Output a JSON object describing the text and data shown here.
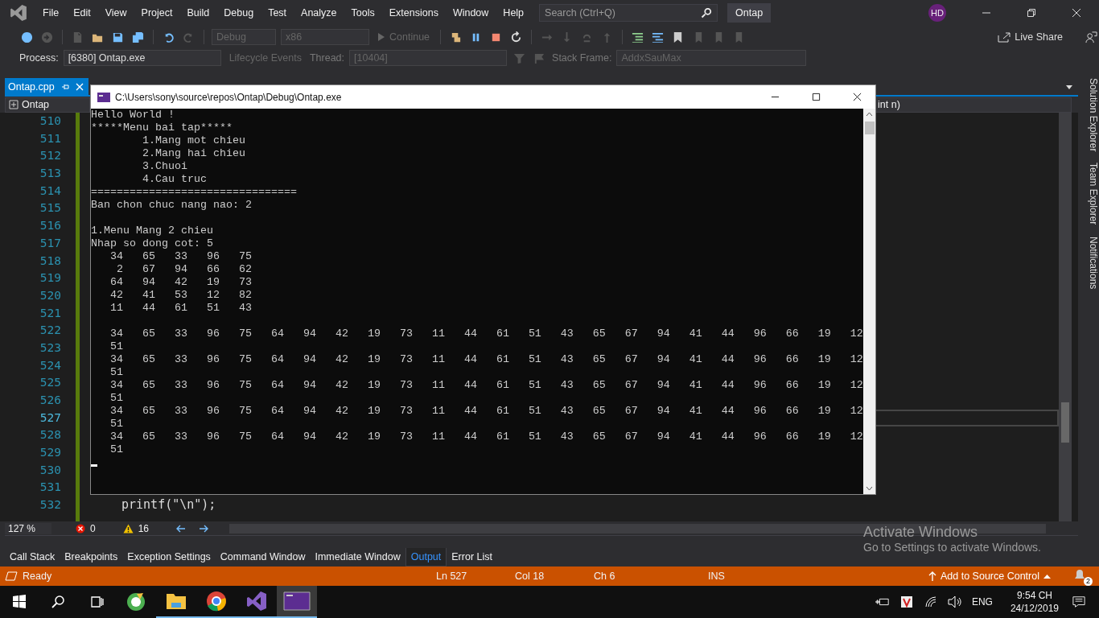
{
  "menu": [
    "File",
    "Edit",
    "View",
    "Project",
    "Build",
    "Debug",
    "Test",
    "Analyze",
    "Tools",
    "Extensions",
    "Window",
    "Help"
  ],
  "search": {
    "placeholder": "Search (Ctrl+Q)"
  },
  "solution_name": "Ontap",
  "account": {
    "initials": "HD"
  },
  "toolbar": {
    "configuration": {
      "value": "Debug",
      "disabled": true
    },
    "platform": {
      "value": "x86",
      "disabled": true
    },
    "continue": {
      "label": "Continue",
      "disabled": true
    },
    "live_share": "Live Share"
  },
  "debug_location": {
    "process": {
      "label": "Process:",
      "value": "[6380] Ontap.exe",
      "disabled": false
    },
    "lifecycle": {
      "label": "Lifecycle Events",
      "disabled": true
    },
    "thread": {
      "label": "Thread:",
      "value": "[10404]",
      "disabled": true
    },
    "stack_frame": {
      "label": "Stack Frame:",
      "value": "AddxSauMax",
      "disabled": true
    }
  },
  "document_tabs": [
    {
      "label": "Ontap.cpp",
      "selected": true
    }
  ],
  "navigation": {
    "project": "Ontap",
    "member": "int n)"
  },
  "editor": {
    "lines": [
      {
        "number": "510",
        "current": false
      },
      {
        "number": "511",
        "current": false
      },
      {
        "number": "512",
        "current": false
      },
      {
        "number": "513",
        "current": false
      },
      {
        "number": "514",
        "current": false
      },
      {
        "number": "515",
        "current": false
      },
      {
        "number": "516",
        "current": false
      },
      {
        "number": "517",
        "current": false
      },
      {
        "number": "518",
        "current": false
      },
      {
        "number": "519",
        "current": false
      },
      {
        "number": "520",
        "current": false
      },
      {
        "number": "521",
        "current": false
      },
      {
        "number": "522",
        "current": false
      },
      {
        "number": "523",
        "current": false
      },
      {
        "number": "524",
        "current": false
      },
      {
        "number": "525",
        "current": false
      },
      {
        "number": "526",
        "current": false
      },
      {
        "number": "527",
        "current": true
      },
      {
        "number": "528",
        "current": false
      },
      {
        "number": "529",
        "current": false
      },
      {
        "number": "530",
        "current": false
      },
      {
        "number": "531",
        "current": false
      },
      {
        "number": "532",
        "current": false,
        "code": "printf(\"\\n\");"
      }
    ]
  },
  "editor_status": {
    "zoom": "127 %",
    "errors": "0",
    "warnings": "16"
  },
  "console": {
    "title": "C:\\Users\\sony\\source\\repos\\Ontap\\Debug\\Ontap.exe",
    "sections": [
      [
        "Hello World !",
        "*****Menu bai tap*****",
        "        1.Mang mot chieu",
        "        2.Mang hai chieu",
        "        3.Chuoi",
        "        4.Cau truc",
        "================================",
        "Ban chon chuc nang nao: 2"
      ],
      [
        "1.Menu Mang 2 chieu",
        "Nhap so dong cot: 5",
        "   34   65   33   96   75",
        "    2   67   94   66   62",
        "   64   94   42   19   73",
        "   42   41   53   12   82",
        "   11   44   61   51   43"
      ],
      [
        "   34   65   33   96   75   64   94   42   19   73   11   44   61   51   43   65   67   94   41   44   96   66   19   12",
        "   51",
        "   34   65   33   96   75   64   94   42   19   73   11   44   61   51   43   65   67   94   41   44   96   66   19   12",
        "   51",
        "   34   65   33   96   75   64   94   42   19   73   11   44   61   51   43   65   67   94   41   44   96   66   19   12",
        "   51",
        "   34   65   33   96   75   64   94   42   19   73   11   44   61   51   43   65   67   94   41   44   96   66   19   12",
        "   51",
        "   34   65   33   96   75   64   94   42   19   73   11   44   61   51   43   65   67   94   41   44   96   66   19   12",
        "   51"
      ]
    ]
  },
  "side_tabs": [
    "Solution Explorer",
    "Team Explorer",
    "Notifications"
  ],
  "tool_tabs": [
    {
      "label": "Call Stack",
      "selected": false
    },
    {
      "label": "Breakpoints",
      "selected": false
    },
    {
      "label": "Exception Settings",
      "selected": false
    },
    {
      "label": "Command Window",
      "selected": false
    },
    {
      "label": "Immediate Window",
      "selected": false
    },
    {
      "label": "Output",
      "selected": true
    },
    {
      "label": "Error List",
      "selected": false
    }
  ],
  "status_bar": {
    "state": "Ready",
    "line": "Ln 527",
    "column": "Col 18",
    "char": "Ch 6",
    "mode": "INS",
    "source_control": "Add to Source Control",
    "notifications": "2"
  },
  "watermark": {
    "title": "Activate Windows",
    "text": "Go to Settings to activate Windows."
  },
  "taskbar": {
    "apps": [
      {
        "kind": "cleaner",
        "running": false,
        "selected": false
      },
      {
        "kind": "folder",
        "running": true,
        "selected": false
      },
      {
        "kind": "browser",
        "running": true,
        "selected": false
      },
      {
        "kind": "studio",
        "running": true,
        "selected": false
      },
      {
        "kind": "console",
        "running": true,
        "selected": true
      }
    ],
    "language": "ENG",
    "time": "9:54 CH",
    "date": "24/12/2019"
  }
}
